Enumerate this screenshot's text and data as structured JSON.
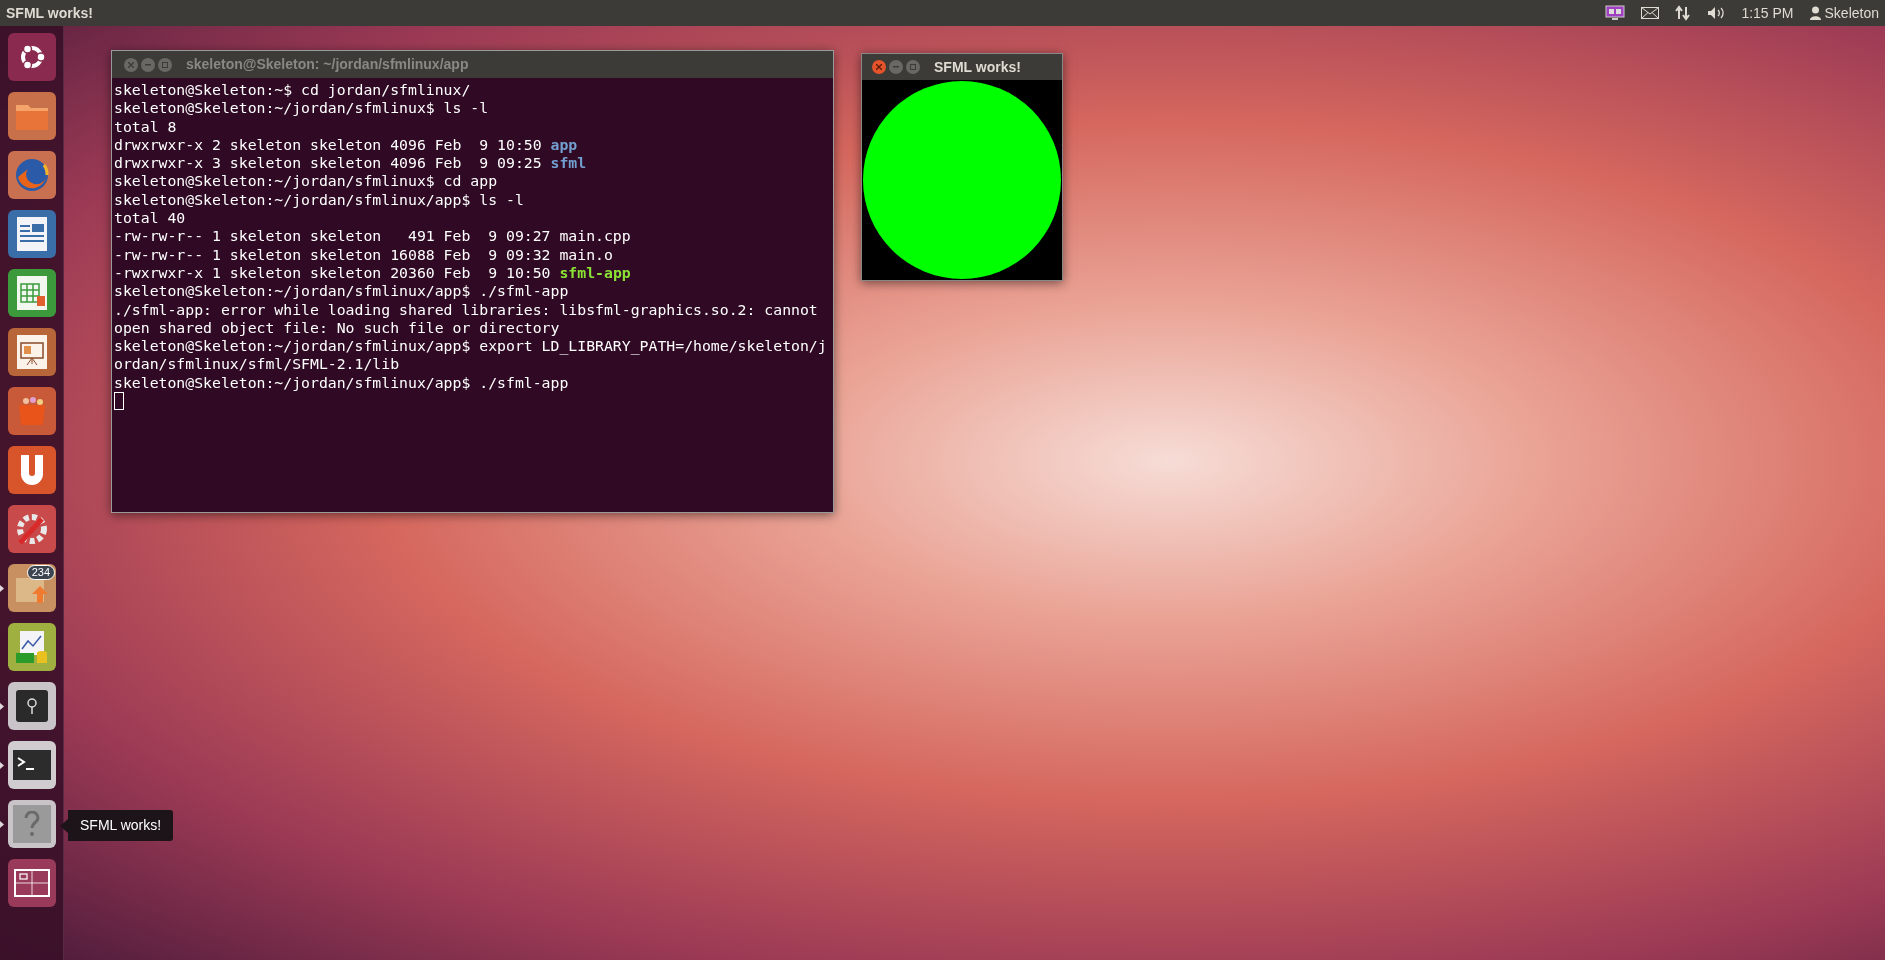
{
  "top_bar": {
    "title": "SFML works!",
    "clock": "1:15 PM",
    "user": "Skeleton"
  },
  "launcher": [
    {
      "kind": "dash",
      "running": false
    },
    {
      "kind": "files",
      "running": false
    },
    {
      "kind": "browser",
      "running": false
    },
    {
      "kind": "writer",
      "running": false
    },
    {
      "kind": "calc",
      "running": false
    },
    {
      "kind": "impress",
      "running": false
    },
    {
      "kind": "store",
      "running": false
    },
    {
      "kind": "u",
      "running": false
    },
    {
      "kind": "settings",
      "running": false
    },
    {
      "kind": "updates",
      "running": true,
      "badge": "234"
    },
    {
      "kind": "finance",
      "running": false
    },
    {
      "kind": "safe",
      "running": true
    },
    {
      "kind": "terminal",
      "running": true
    },
    {
      "kind": "unknown",
      "running": true,
      "tooltip": "SFML works!"
    },
    {
      "kind": "workspaces",
      "running": false
    }
  ],
  "terminal": {
    "title": "skeleton@Skeleton: ~/jordan/sfmlinux/app",
    "lines": [
      {
        "text": "skeleton@Skeleton:~$ cd jordan/sfmlinux/"
      },
      {
        "text": "skeleton@Skeleton:~/jordan/sfmlinux$ ls -l"
      },
      {
        "text": "total 8"
      },
      {
        "text": "drwxrwxr-x 2 skeleton skeleton 4096 Feb  9 10:50 ",
        "file": {
          "name": "app",
          "kind": "dir"
        }
      },
      {
        "text": "drwxrwxr-x 3 skeleton skeleton 4096 Feb  9 09:25 ",
        "file": {
          "name": "sfml",
          "kind": "dir"
        }
      },
      {
        "text": "skeleton@Skeleton:~/jordan/sfmlinux$ cd app"
      },
      {
        "text": "skeleton@Skeleton:~/jordan/sfmlinux/app$ ls -l"
      },
      {
        "text": "total 40"
      },
      {
        "text": "-rw-rw-r-- 1 skeleton skeleton   491 Feb  9 09:27 main.cpp"
      },
      {
        "text": "-rw-rw-r-- 1 skeleton skeleton 16088 Feb  9 09:32 main.o"
      },
      {
        "text": "-rwxrwxr-x 1 skeleton skeleton 20360 Feb  9 10:50 ",
        "file": {
          "name": "sfml-app",
          "kind": "exec"
        }
      },
      {
        "text": "skeleton@Skeleton:~/jordan/sfmlinux/app$ ./sfml-app"
      },
      {
        "text": "./sfml-app: error while loading shared libraries: libsfml-graphics.so.2: cannot"
      },
      {
        "text": "open shared object file: No such file or directory"
      },
      {
        "text": "skeleton@Skeleton:~/jordan/sfmlinux/app$ export LD_LIBRARY_PATH=/home/skeleton/j"
      },
      {
        "text": "ordan/sfmlinux/sfml/SFML-2.1/lib"
      },
      {
        "text": "skeleton@Skeleton:~/jordan/sfmlinux/app$ ./sfml-app"
      }
    ]
  },
  "sfml_window": {
    "title": "SFML works!"
  }
}
